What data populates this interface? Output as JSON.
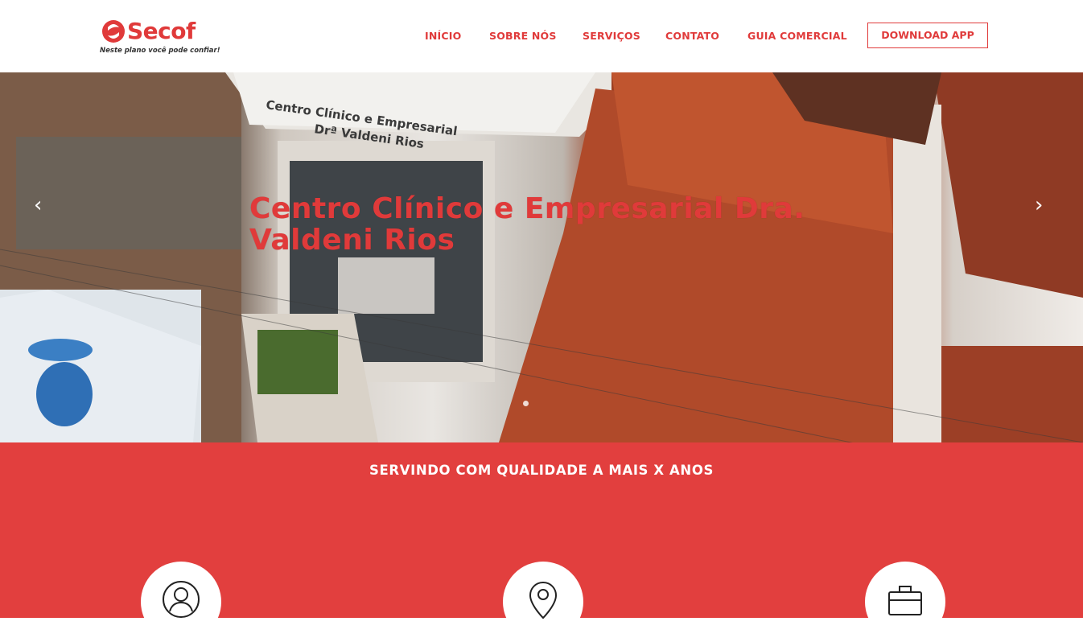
{
  "brand": {
    "name": "Secof",
    "tagline": "Neste plano você pode confiar!",
    "color": "#e03a3a"
  },
  "nav": {
    "items": [
      {
        "label": "INÍCIO"
      },
      {
        "label": "SOBRE NÓS"
      },
      {
        "label": "SERVIÇOS"
      },
      {
        "label": "CONTATO"
      },
      {
        "label": "GUIA COMERCIAL"
      }
    ],
    "cta_label": "DOWNLOAD APP"
  },
  "hero": {
    "title": "Centro Clínico e Empresarial Dra. Valdeni Rios",
    "prev_icon": "‹",
    "next_icon": "›",
    "active_slide": 1
  },
  "features": {
    "heading": "SERVINDO COM QUALIDADE A MAIS X ANOS",
    "icons": [
      "user-icon",
      "map-pin-icon",
      "briefcase-icon"
    ],
    "band_color": "#e23f3e"
  }
}
